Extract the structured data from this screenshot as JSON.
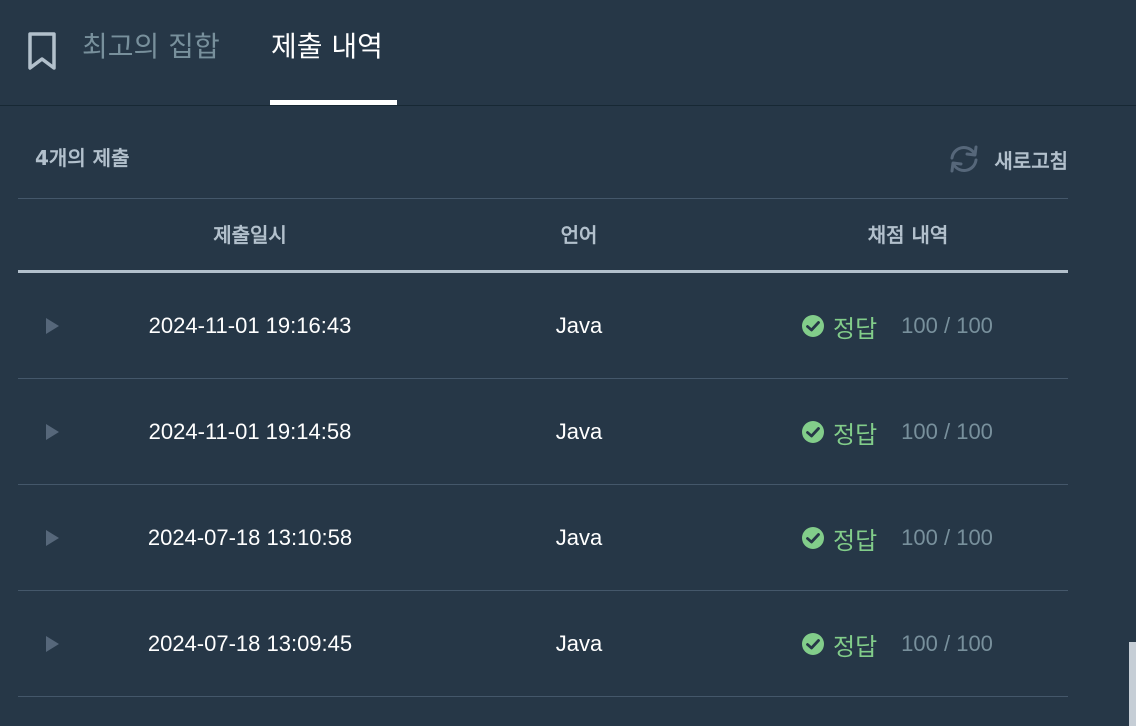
{
  "tabs": [
    {
      "label": "최고의 집합",
      "active": false
    },
    {
      "label": "제출 내역",
      "active": true
    }
  ],
  "summary": {
    "count_label": "4개의 제출",
    "refresh_label": "새로고침"
  },
  "table": {
    "columns": [
      "제출일시",
      "언어",
      "채점 내역"
    ],
    "rows": [
      {
        "datetime": "2024-11-01 19:16:43",
        "language": "Java",
        "verdict": "정답",
        "score": "100 / 100"
      },
      {
        "datetime": "2024-11-01 19:14:58",
        "language": "Java",
        "verdict": "정답",
        "score": "100 / 100"
      },
      {
        "datetime": "2024-07-18 13:10:58",
        "language": "Java",
        "verdict": "정답",
        "score": "100 / 100"
      },
      {
        "datetime": "2024-07-18 13:09:45",
        "language": "Java",
        "verdict": "정답",
        "score": "100 / 100"
      }
    ]
  },
  "colors": {
    "background": "#263747",
    "accent_success": "#82cd8a",
    "muted": "#78909c",
    "header_text": "#b2c0cc"
  },
  "icons": {
    "bookmark": "bookmark-icon",
    "refresh": "refresh-icon",
    "expand": "play-arrow-icon",
    "success": "check-circle-icon"
  }
}
